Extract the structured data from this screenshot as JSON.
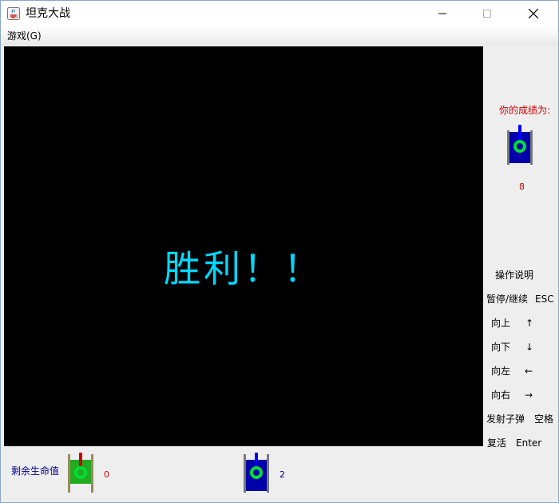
{
  "window": {
    "title": "坦克大战",
    "icon": "java-coffee-icon"
  },
  "menu": {
    "game": "游戏(G)"
  },
  "game": {
    "message": "胜利！！"
  },
  "side": {
    "score_label": "你的成绩为:",
    "score_value": "8",
    "help_title": "操作说明",
    "controls": [
      {
        "action": "暂停/继续",
        "key": "ESC"
      },
      {
        "action": "向上",
        "key": "↑"
      },
      {
        "action": "向下",
        "key": "↓"
      },
      {
        "action": "向左",
        "key": "←"
      },
      {
        "action": "向右",
        "key": "→"
      },
      {
        "action": "发射子弹",
        "key": "空格"
      },
      {
        "action": "复活",
        "key": "Enter"
      }
    ]
  },
  "bottom": {
    "lives_label": "剩余生命值",
    "player_lives": "0",
    "enemy_count": "2"
  },
  "colors": {
    "victory_text": "#00d8ff",
    "score_text": "#cc0000",
    "lives_label": "#00008b",
    "player_tank_body": "#22aa22",
    "player_tank_barrel": "#cc0000",
    "enemy_tank_body": "#0000aa",
    "tank_turret": "#00dd33"
  }
}
